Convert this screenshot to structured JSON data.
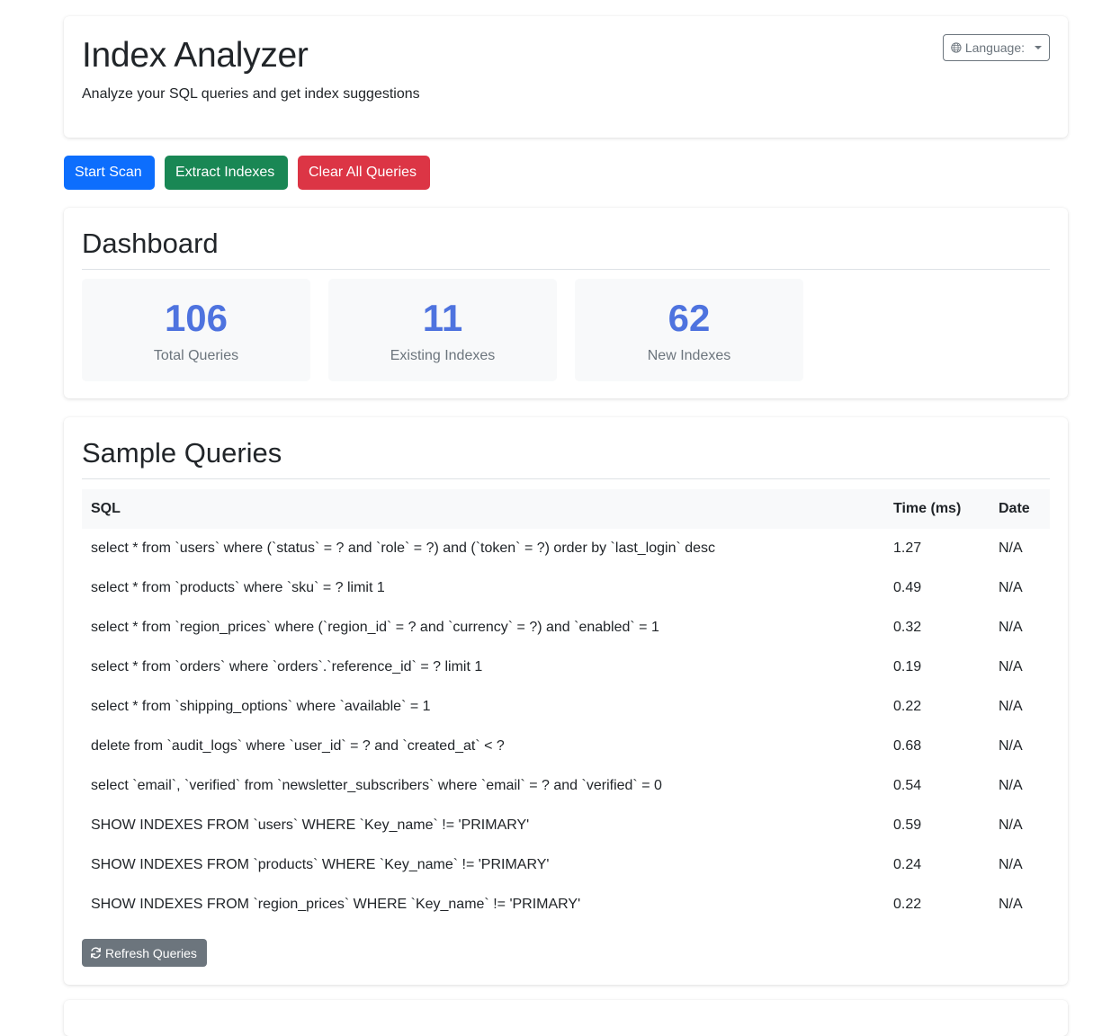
{
  "header": {
    "title": "Index Analyzer",
    "subtitle": "Analyze your SQL queries and get index suggestions",
    "language_label": "Language:"
  },
  "toolbar": {
    "start_scan": "Start Scan",
    "extract_indexes": "Extract Indexes",
    "clear_queries": "Clear All Queries"
  },
  "dashboard": {
    "title": "Dashboard",
    "stats": [
      {
        "value": "106",
        "label": "Total Queries"
      },
      {
        "value": "11",
        "label": "Existing Indexes"
      },
      {
        "value": "62",
        "label": "New Indexes"
      }
    ]
  },
  "queries": {
    "title": "Sample Queries",
    "columns": [
      "SQL",
      "Time (ms)",
      "Date"
    ],
    "rows": [
      {
        "sql": "select * from `users` where (`status` = ? and `role` = ?) and (`token` = ?) order by `last_login` desc",
        "time": "1.27",
        "date": "N/A"
      },
      {
        "sql": "select * from `products` where `sku` = ? limit 1",
        "time": "0.49",
        "date": "N/A"
      },
      {
        "sql": "select * from `region_prices` where (`region_id` = ? and `currency` = ?) and `enabled` = 1",
        "time": "0.32",
        "date": "N/A"
      },
      {
        "sql": "select * from `orders` where `orders`.`reference_id` = ? limit 1",
        "time": "0.19",
        "date": "N/A"
      },
      {
        "sql": "select * from `shipping_options` where `available` = 1",
        "time": "0.22",
        "date": "N/A"
      },
      {
        "sql": "delete from `audit_logs` where `user_id` = ? and `created_at` < ?",
        "time": "0.68",
        "date": "N/A"
      },
      {
        "sql": "select `email`, `verified` from `newsletter_subscribers` where `email` = ? and `verified` = 0",
        "time": "0.54",
        "date": "N/A"
      },
      {
        "sql": "SHOW INDEXES FROM `users` WHERE `Key_name` != 'PRIMARY'",
        "time": "0.59",
        "date": "N/A"
      },
      {
        "sql": "SHOW INDEXES FROM `products` WHERE `Key_name` != 'PRIMARY'",
        "time": "0.24",
        "date": "N/A"
      },
      {
        "sql": "SHOW INDEXES FROM `region_prices` WHERE `Key_name` != 'PRIMARY'",
        "time": "0.22",
        "date": "N/A"
      }
    ],
    "refresh_label": "Refresh Queries"
  },
  "icons": {
    "language": "globe-icon",
    "refresh": "refresh-icon"
  },
  "colors": {
    "primary": "#0d6efd",
    "success": "#198754",
    "danger": "#dc3545",
    "secondary": "#6c757d",
    "stat_number": "#4e73df"
  }
}
